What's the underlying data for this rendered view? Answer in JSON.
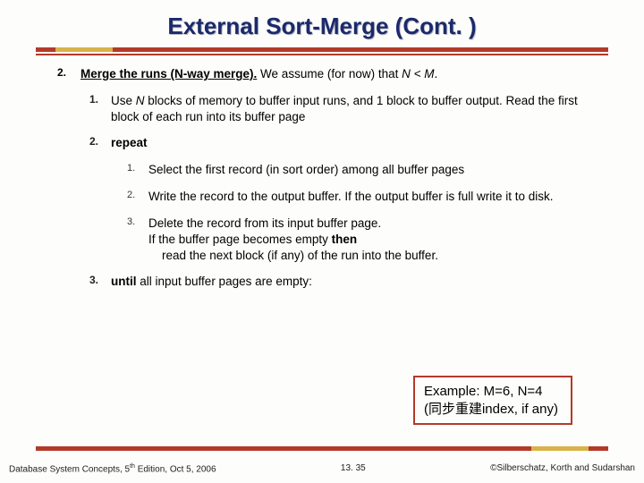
{
  "title": "External Sort-Merge (Cont. )",
  "step2": {
    "number": "2.",
    "lead": "Merge the runs (N-way merge).",
    "assume_pre": " We assume (for now) that ",
    "assume_rel": "N < M",
    "assume_post": ".",
    "sub1": {
      "number": "1.",
      "pre": "Use ",
      "var": "N",
      "post": " blocks of memory to buffer input runs, and 1 block to buffer output. Read the first block of each run into its buffer page"
    },
    "sub2": {
      "number": "2.",
      "label": "repeat",
      "r1": {
        "number": "1.",
        "text": "Select the first record (in sort order) among all buffer pages"
      },
      "r2": {
        "number": "2.",
        "text": "Write the record to the output buffer.  If the output buffer is full write it to disk."
      },
      "r3": {
        "number": "3.",
        "line1": "Delete the record from its input buffer page.",
        "line2_a": "If the buffer page becomes empty ",
        "line2_b": "then",
        "line3": "    read the next block (if any) of the run into the buffer."
      }
    },
    "sub3": {
      "number": "3.",
      "label": "until",
      "rest": " all input buffer pages are empty:"
    }
  },
  "example": {
    "line1": "Example: M=6, N=4",
    "line2": "(同步重建index, if any)"
  },
  "footer": {
    "left_a": "Database System Concepts, 5",
    "left_sup": "th",
    "left_b": " Edition, Oct 5, 2006",
    "mid": "13. 35",
    "right": "©Silberschatz, Korth and Sudarshan"
  }
}
